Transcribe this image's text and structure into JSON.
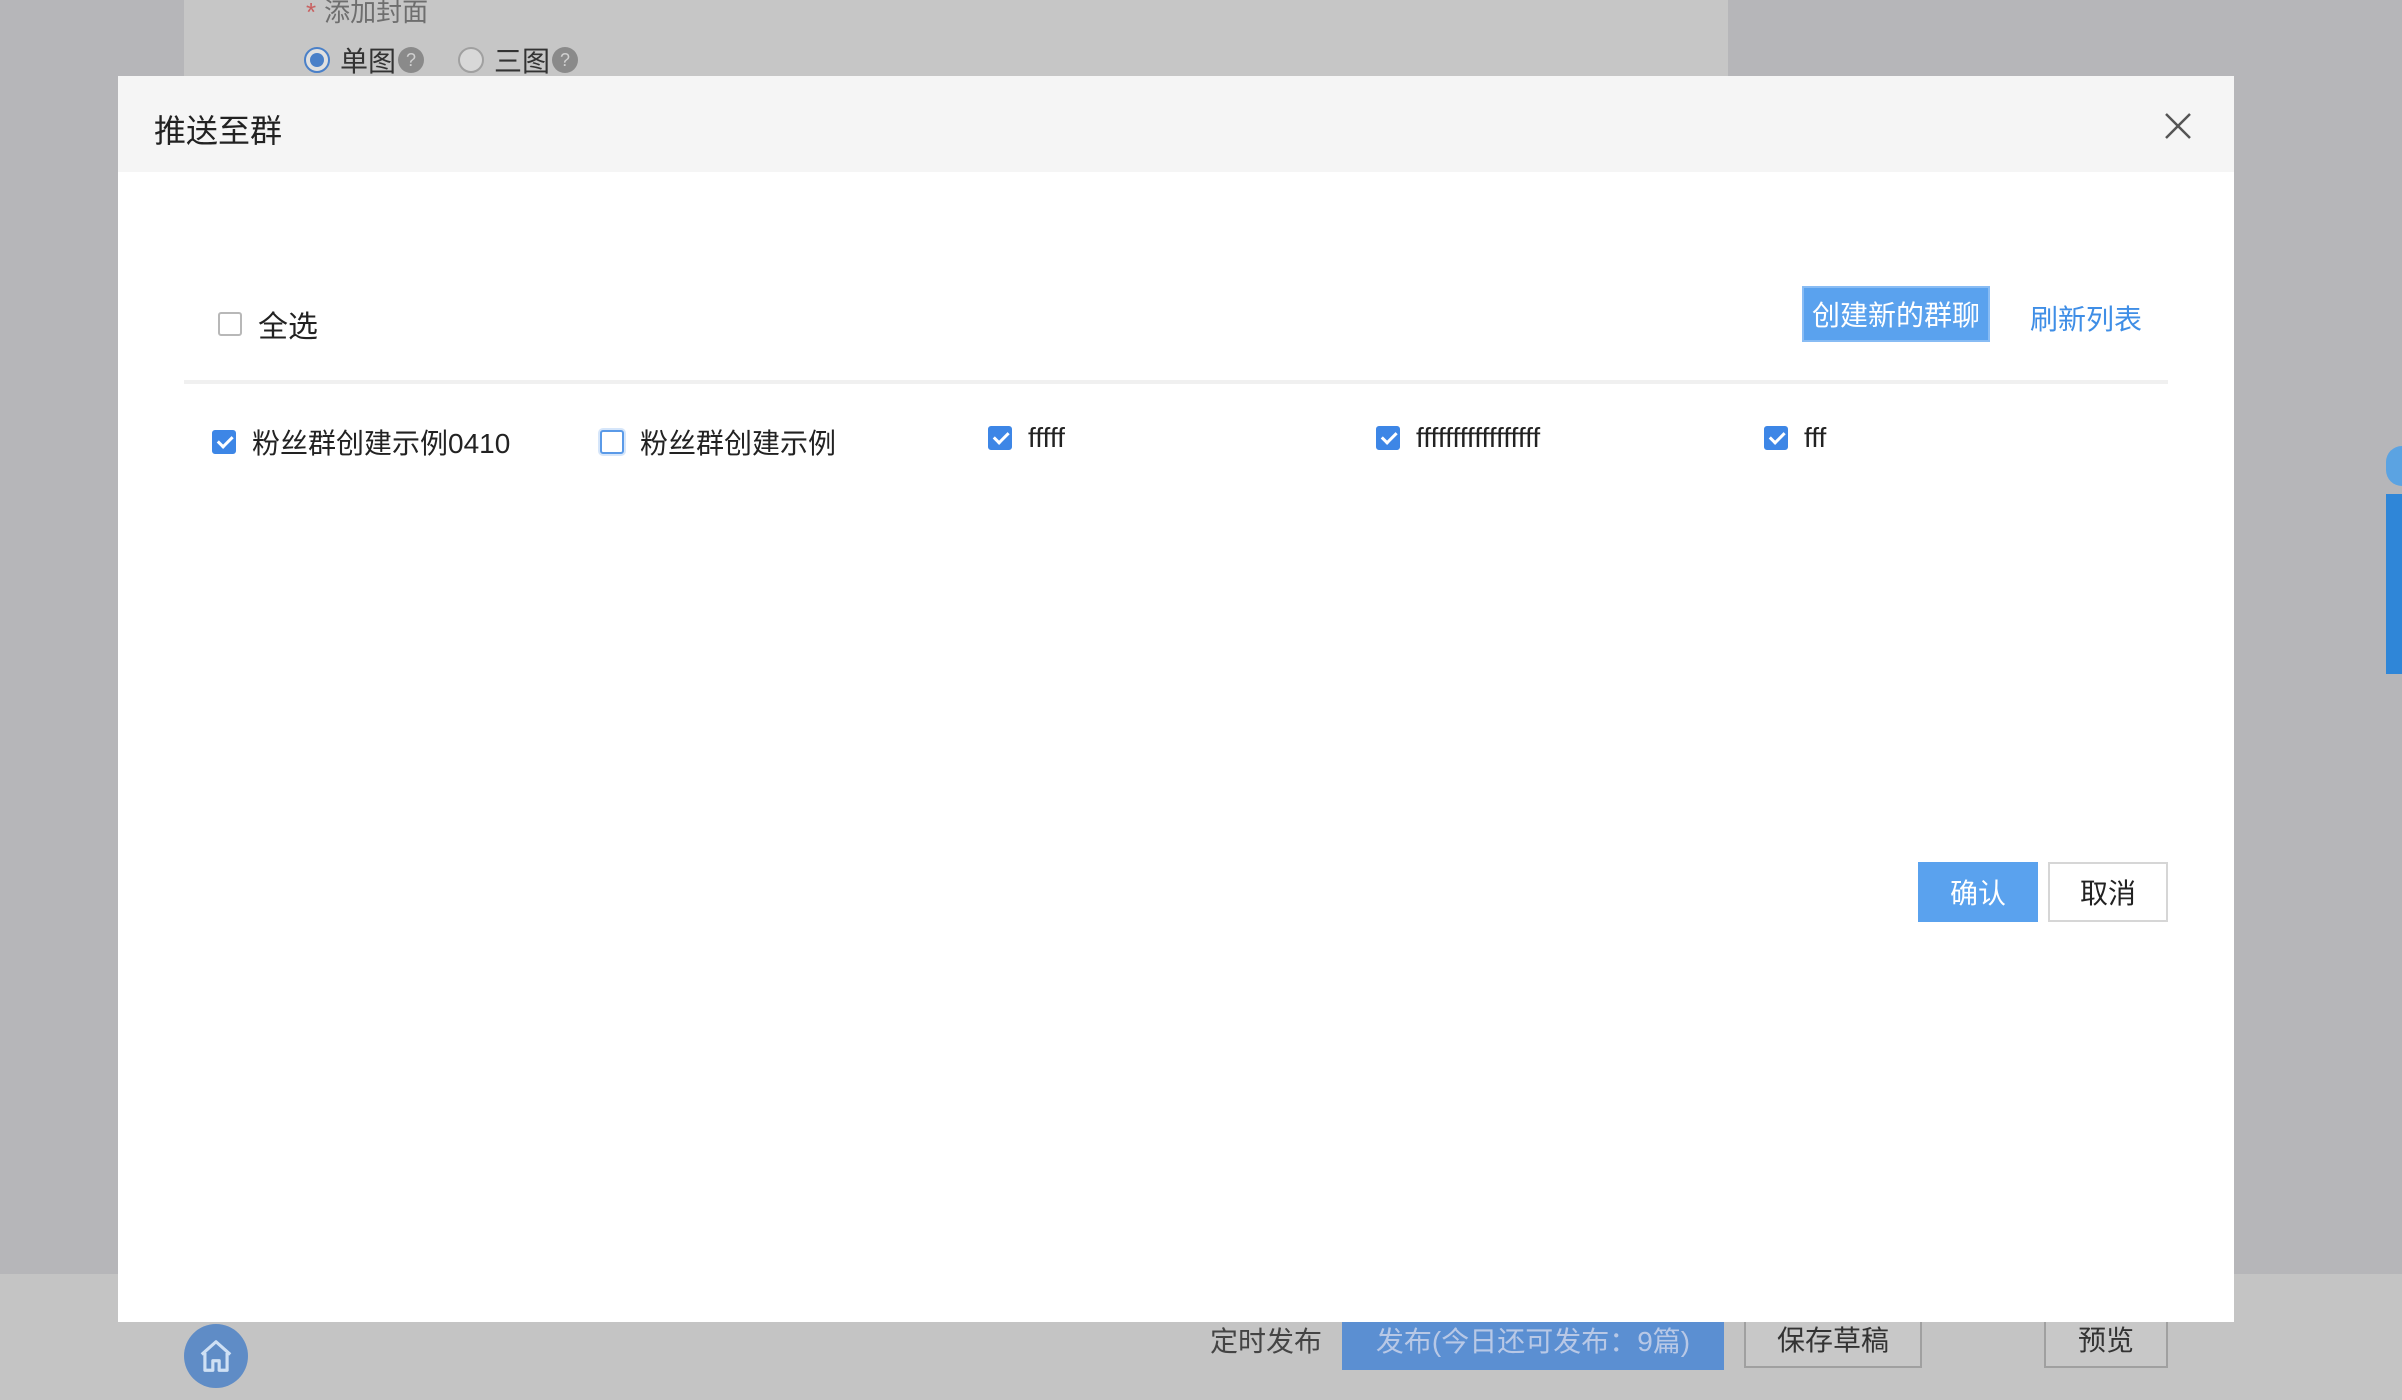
{
  "background": {
    "cover_label": "添加封面",
    "required_mark": "*",
    "cover_options": [
      {
        "label": "单图",
        "selected": true
      },
      {
        "label": "三图",
        "selected": false
      }
    ],
    "help_glyph": "?",
    "footer": {
      "schedule_label": "定时发布",
      "publish_label": "发布(今日还可发布：9篇)",
      "save_draft_label": "保存草稿",
      "preview_label": "预览"
    }
  },
  "modal": {
    "title": "推送至群",
    "select_all_label": "全选",
    "select_all_checked": false,
    "create_group_label": "创建新的群聊",
    "refresh_label": "刷新列表",
    "groups": [
      {
        "name": "粉丝群创建示例0410",
        "checked": true
      },
      {
        "name": "粉丝群创建示例",
        "checked": false
      },
      {
        "name": "fffff",
        "checked": true
      },
      {
        "name": "fffffffffffffffff",
        "checked": true
      },
      {
        "name": "fff",
        "checked": true
      }
    ],
    "confirm_label": "确认",
    "cancel_label": "取消"
  },
  "colors": {
    "accent": "#5aa2ee",
    "checkbox_checked": "#3d86e6",
    "link": "#3f8ee6",
    "overlay": "#b6b6b9"
  }
}
